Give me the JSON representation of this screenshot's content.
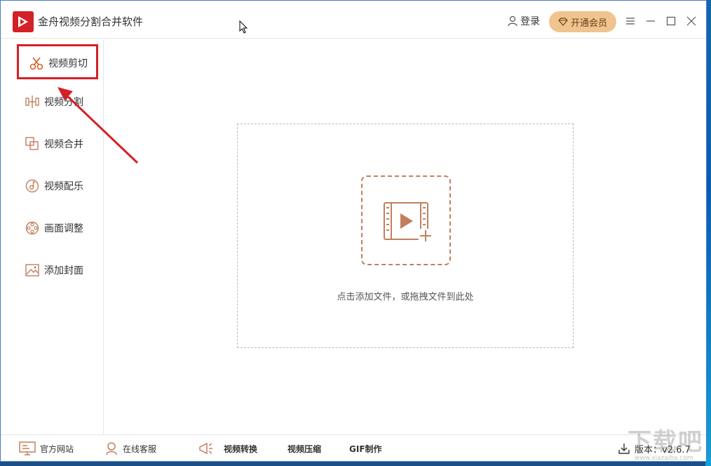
{
  "app": {
    "title": "金舟视频分割合并软件",
    "login_label": "登录",
    "vip_label": "开通会员",
    "brand_color": "#d42027",
    "accent_color": "#c0805e"
  },
  "sidebar": {
    "items": [
      {
        "label": "视频剪切",
        "icon": "scissors-icon",
        "active": true
      },
      {
        "label": "视频分割",
        "icon": "split-icon"
      },
      {
        "label": "视频合并",
        "icon": "merge-icon"
      },
      {
        "label": "视频配乐",
        "icon": "music-icon"
      },
      {
        "label": "画面调整",
        "icon": "film-reel-icon"
      },
      {
        "label": "添加封面",
        "icon": "image-icon"
      }
    ]
  },
  "main": {
    "drop_text": "点击添加文件，或拖拽文件到此处"
  },
  "footer": {
    "website": "官方网站",
    "support": "在线客服",
    "convert": "视频转换",
    "compress": "视频压缩",
    "gif": "GIF制作",
    "version": "版本：v2.6.7"
  },
  "watermark": {
    "text": "下载吧",
    "url": "www.xiazaiba.com"
  }
}
